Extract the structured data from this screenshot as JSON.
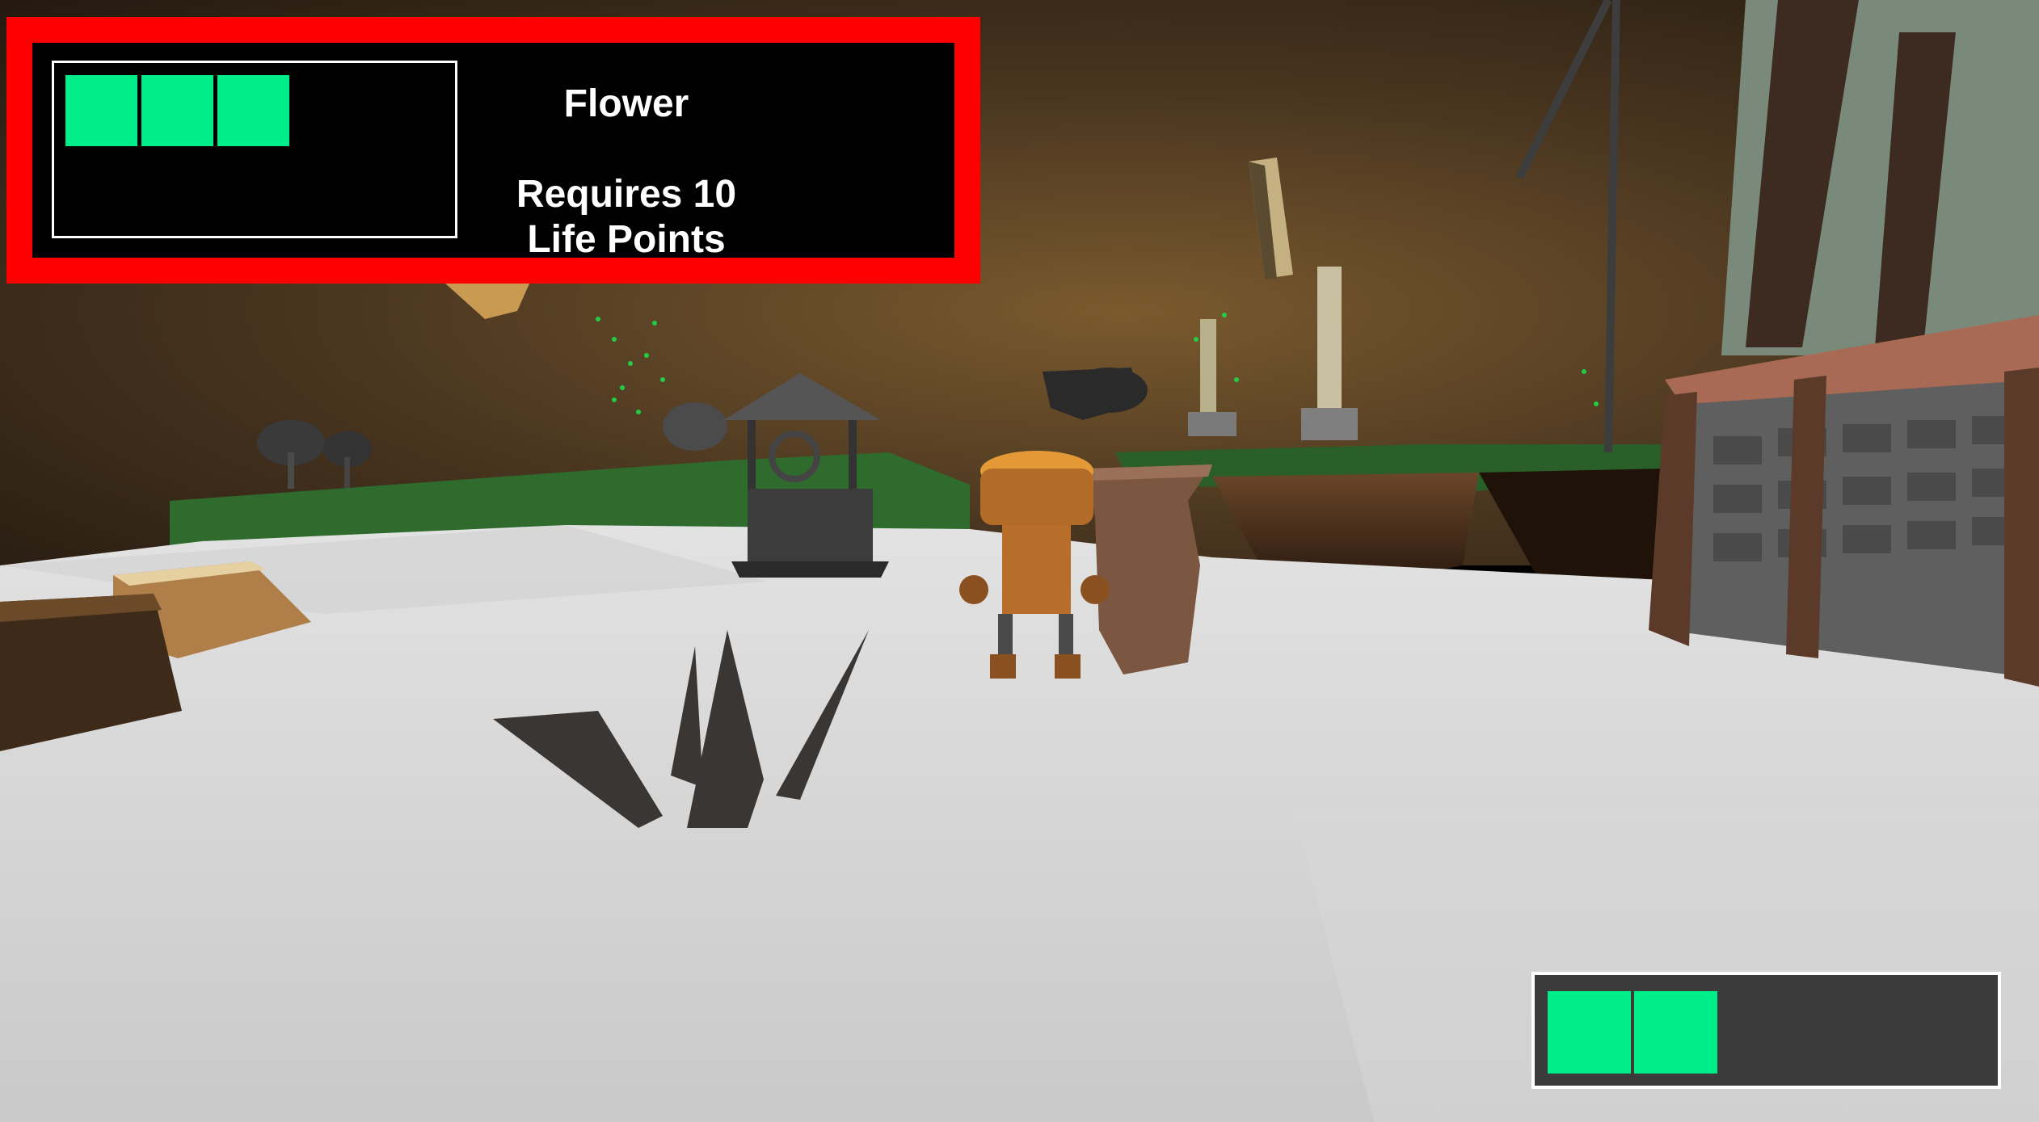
{
  "requirement_panel": {
    "item_name": "Flower",
    "requirement_text": "Requires 10 Life Points",
    "slots_filled": 3,
    "border_color": "#ff0000",
    "cell_color": "#00ee8a"
  },
  "life_meter": {
    "cells_filled": 2,
    "cell_color": "#00ee8a"
  },
  "scene": {
    "objects": [
      "robot-character",
      "clay-pot",
      "wishing-well",
      "tree-stumps",
      "grass-spikes",
      "windmill",
      "ruined-pillars",
      "floating-rock",
      "mushroom-trees"
    ]
  }
}
